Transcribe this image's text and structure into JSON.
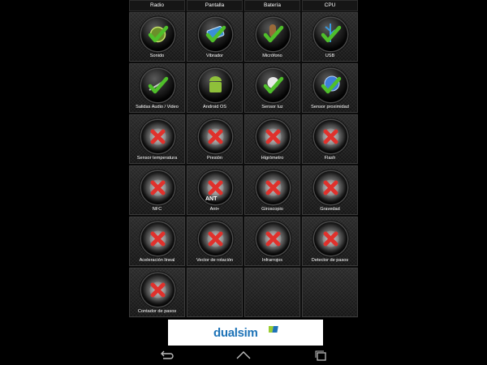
{
  "top_tabs": [
    "Radio",
    "Pantalla",
    "Batería",
    "CPU"
  ],
  "sensors": [
    {
      "label": "Sonido",
      "icon": "speaker-check-icon",
      "status": "ok"
    },
    {
      "label": "Vibrador",
      "icon": "vibrator-check-icon",
      "status": "ok"
    },
    {
      "label": "Micrófono",
      "icon": "microphone-check-icon",
      "status": "ok"
    },
    {
      "label": "USB",
      "icon": "usb-check-icon",
      "status": "ok"
    },
    {
      "label": "Salidas Audio / Video",
      "icon": "audio-video-check-icon",
      "status": "ok"
    },
    {
      "label": "Android OS",
      "icon": "android-icon",
      "status": "ok"
    },
    {
      "label": "Sensor luz",
      "icon": "light-bulb-check-icon",
      "status": "ok"
    },
    {
      "label": "Sensor proximidad",
      "icon": "proximity-check-icon",
      "status": "ok"
    },
    {
      "label": "Sensor temperatura",
      "icon": "thermometer-x-icon",
      "status": "missing"
    },
    {
      "label": "Presión",
      "icon": "pressure-x-icon",
      "status": "missing"
    },
    {
      "label": "Higrómetro",
      "icon": "hygrometer-x-icon",
      "status": "missing"
    },
    {
      "label": "Flash",
      "icon": "flash-x-icon",
      "status": "missing"
    },
    {
      "label": "NFC",
      "icon": "nfc-x-icon",
      "status": "missing"
    },
    {
      "label": "Ant+",
      "icon": "ant-plus-x-icon",
      "status": "missing",
      "badge": "ANT"
    },
    {
      "label": "Giroscopio",
      "icon": "gyroscope-x-icon",
      "status": "missing"
    },
    {
      "label": "Gravedad",
      "icon": "gravity-x-icon",
      "status": "missing"
    },
    {
      "label": "Aceleración lineal",
      "icon": "linear-acceleration-x-icon",
      "status": "missing"
    },
    {
      "label": "Vector de rotación",
      "icon": "rotation-vector-x-icon",
      "status": "missing"
    },
    {
      "label": "Infrarrojos",
      "icon": "infrared-x-icon",
      "status": "missing"
    },
    {
      "label": "Detector de pasos",
      "icon": "step-detector-x-icon",
      "status": "missing"
    },
    {
      "label": "Contador de pasos",
      "icon": "step-counter-x-icon",
      "status": "missing"
    }
  ],
  "ad": {
    "brand": "dualsim"
  },
  "colors": {
    "ok_green": "#4fbf2a",
    "missing_red": "#e0312c",
    "brand_blue": "#1e73b7"
  }
}
